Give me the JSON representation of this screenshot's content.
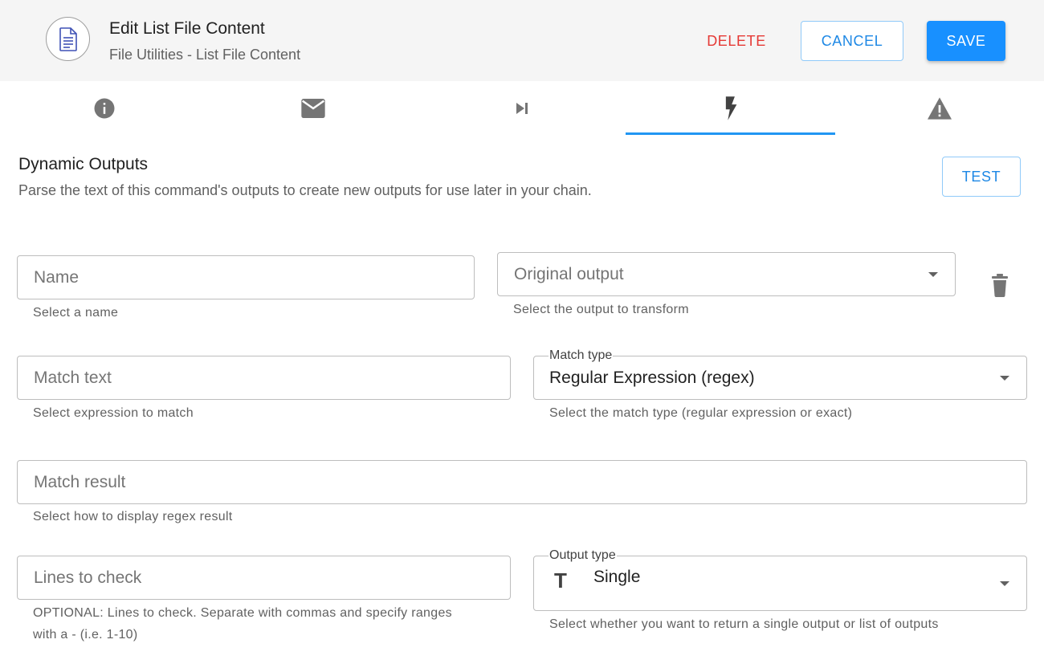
{
  "header": {
    "title": "Edit List File Content",
    "subtitle": "File Utilities - List File Content",
    "icon": "document-icon",
    "delete_label": "DELETE",
    "cancel_label": "CANCEL",
    "save_label": "SAVE"
  },
  "tabs": [
    {
      "icon": "info-icon"
    },
    {
      "icon": "mail-icon"
    },
    {
      "icon": "skip-next-icon"
    },
    {
      "icon": "flash-icon",
      "selected": true
    },
    {
      "icon": "warning-icon"
    }
  ],
  "section": {
    "title": "Dynamic Outputs",
    "description": "Parse the text of this command's outputs to create new outputs for use later in your chain.",
    "test_label": "TEST"
  },
  "form": {
    "name": {
      "placeholder": "Name",
      "helper": "Select a name"
    },
    "original_output": {
      "placeholder": "Original output",
      "helper": "Select the output to transform"
    },
    "match_text": {
      "placeholder": "Match text",
      "helper": "Select expression to match"
    },
    "match_type": {
      "label": "Match type",
      "value": "Regular Expression (regex)",
      "helper": "Select the match type (regular expression or exact)"
    },
    "match_result": {
      "placeholder": "Match result",
      "helper": "Select how to display regex result"
    },
    "lines_to_check": {
      "placeholder": "Lines to check",
      "helper_line1": "OPTIONAL: Lines to check. Separate with commas and specify ranges",
      "helper_line2": "with a - (i.e. 1-10)"
    },
    "output_type": {
      "label": "Output type",
      "value": "Single",
      "value_icon": "text-type-icon",
      "helper": "Select whether you want to return a single output or list of outputs"
    }
  },
  "colors": {
    "accent": "#1890ff",
    "delete": "#e53935",
    "tab_indicator": "#2196f3"
  }
}
